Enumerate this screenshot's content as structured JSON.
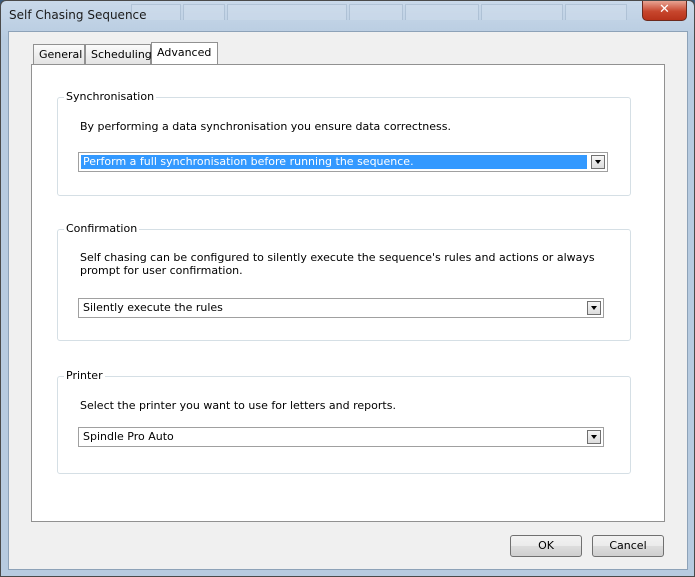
{
  "window": {
    "title": "Self Chasing Sequence",
    "close_label": "✕"
  },
  "tabs": [
    {
      "label": "General"
    },
    {
      "label": "Scheduling"
    },
    {
      "label": "Advanced"
    }
  ],
  "active_tab": "Advanced",
  "synchronisation": {
    "title": "Synchronisation",
    "description": "By performing a data synchronisation you ensure data correctness.",
    "selected": "Perform a full synchronisation before running the sequence."
  },
  "confirmation": {
    "title": "Confirmation",
    "description": "Self chasing can be configured to silently execute the sequence's rules and actions or always prompt for user confirmation.",
    "selected": "Silently execute the rules"
  },
  "printer": {
    "title": "Printer",
    "description": "Select the printer you want to use for letters and reports.",
    "selected": "Spindle Pro Auto"
  },
  "buttons": {
    "ok": "OK",
    "cancel": "Cancel"
  },
  "icons": {
    "close": "close-icon",
    "dropdown": "chevron-down-icon"
  },
  "colors": {
    "selection": "#3399ff",
    "close_button": "#c7462d"
  }
}
